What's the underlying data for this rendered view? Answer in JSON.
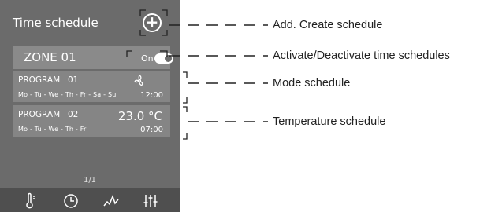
{
  "screen": {
    "title": "Time schedule",
    "add_icon": "plus-circle-icon",
    "zone": {
      "name": "ZONE 01",
      "state_label": "On",
      "toggle_on": true
    },
    "programs": [
      {
        "label": "PROGRAM",
        "number": "01",
        "mode_icon": "fan-icon",
        "days": "Mo - Tu - We - Th - Fr - Sa - Su",
        "time": "12:00"
      },
      {
        "label": "PROGRAM",
        "number": "02",
        "temperature": "23.0 °C",
        "days": "Mo - Tu - We - Th - Fr",
        "time": "07:00"
      }
    ],
    "page_indicator": "1/1",
    "nav_icons": [
      "thermometer-icon",
      "clock-icon",
      "graph-icon",
      "sliders-icon"
    ]
  },
  "callouts": [
    "Add. Create schedule",
    "Activate/Deactivate time schedules",
    "Mode schedule",
    "Temperature schedule"
  ],
  "colors": {
    "screen_bg": "#6b6b6b",
    "card_bg": "#858585",
    "zone_bg": "#8a8a8a",
    "nav_bg": "#4f4f4f",
    "text": "#ffffff"
  }
}
